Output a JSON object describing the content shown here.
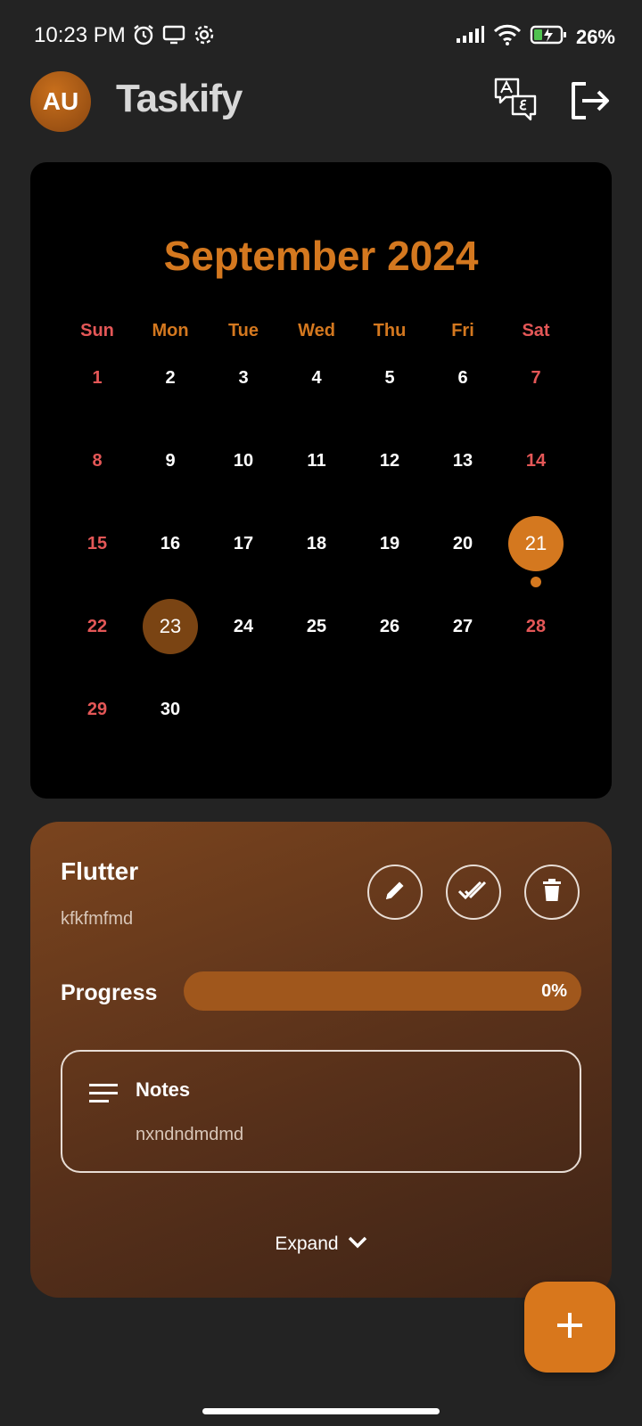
{
  "status_bar": {
    "time": "10:23 PM",
    "battery_percent": "26%"
  },
  "app_bar": {
    "avatar_initials": "AU",
    "title": "Taskify"
  },
  "calendar": {
    "month_title": "September 2024",
    "weekdays": [
      "Sun",
      "Mon",
      "Tue",
      "Wed",
      "Thu",
      "Fri",
      "Sat"
    ],
    "weeks": [
      [
        "1",
        "2",
        "3",
        "4",
        "5",
        "6",
        "7"
      ],
      [
        "8",
        "9",
        "10",
        "11",
        "12",
        "13",
        "14"
      ],
      [
        "15",
        "16",
        "17",
        "18",
        "19",
        "20",
        "21"
      ],
      [
        "22",
        "23",
        "24",
        "25",
        "26",
        "27",
        "28"
      ],
      [
        "29",
        "30"
      ]
    ],
    "selected_day": "21",
    "today": "23",
    "event_days": [
      "21"
    ]
  },
  "task": {
    "title": "Flutter",
    "description": "kfkfmfmd",
    "progress_label": "Progress",
    "progress_value": "0%",
    "progress_fraction": 0,
    "notes_title": "Notes",
    "notes_text": "nxndndmdmd",
    "expand_label": "Expand"
  },
  "colors": {
    "accent": "#d4781f",
    "weekend": "#e45757",
    "background": "#232323",
    "calendar_bg": "#000000"
  }
}
